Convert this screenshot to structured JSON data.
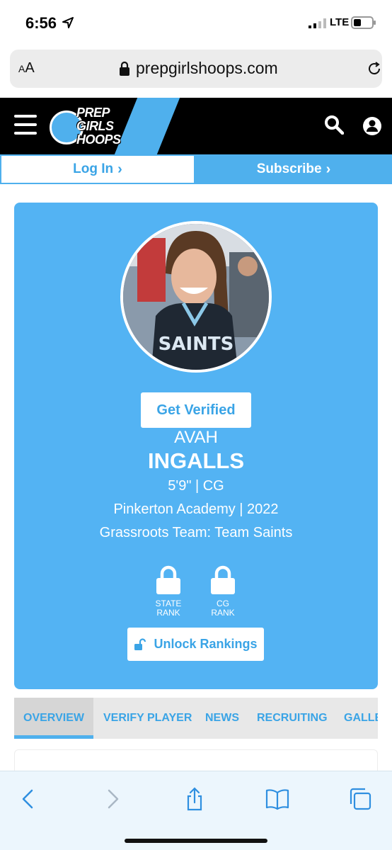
{
  "status_bar": {
    "time": "6:56",
    "network": "LTE"
  },
  "browser": {
    "aa_label_small": "A",
    "aa_label": "A",
    "url": "prepgirlshoops.com"
  },
  "header": {
    "logo_lines": [
      "PREP",
      "GIRLS",
      "HOOPS"
    ]
  },
  "auth": {
    "login_label": "Log In",
    "subscribe_label": "Subscribe"
  },
  "profile": {
    "verify_label": "Get Verified",
    "first_name": "AVAH",
    "last_name": "INGALLS",
    "height_position": "5'9\" | CG",
    "school_class": "Pinkerton Academy | 2022",
    "grassroots": "Grassroots Team: Team Saints",
    "ranks": [
      {
        "line1": "STATE",
        "line2": "RANK"
      },
      {
        "line1": "CG",
        "line2": "RANK"
      }
    ],
    "unlock_label": "Unlock Rankings",
    "jersey_text": "SAINTS"
  },
  "tabs": [
    {
      "label": "OVERVIEW",
      "active": true
    },
    {
      "label": "VERIFY PLAYER",
      "active": false
    },
    {
      "label": "NEWS",
      "active": false
    },
    {
      "label": "RECRUITING",
      "active": false
    },
    {
      "label": "GALLE",
      "active": false
    }
  ],
  "colors": {
    "brand_blue": "#53b3f3",
    "link_blue": "#3aa4e6",
    "black": "#000000"
  }
}
